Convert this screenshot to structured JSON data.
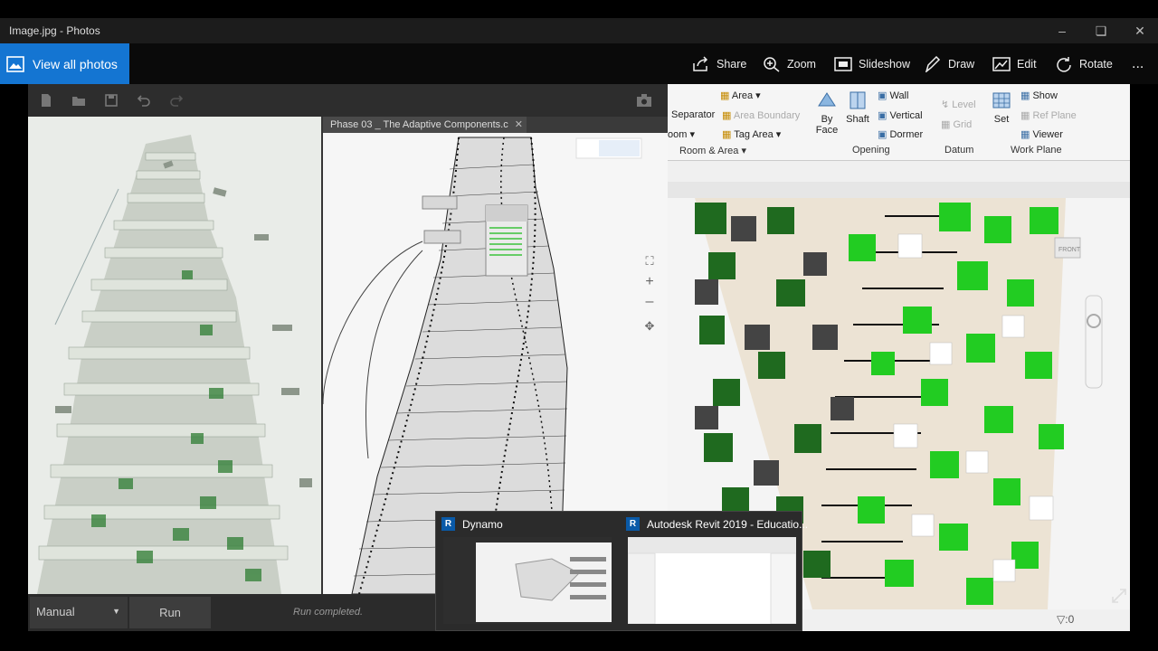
{
  "window": {
    "title": "Image.jpg - Photos"
  },
  "photos_toolbar": {
    "view_all": "View all photos",
    "buttons": [
      "Share",
      "Zoom",
      "Slideshow",
      "Draw",
      "Edit",
      "Rotate"
    ],
    "more": "..."
  },
  "dynamo": {
    "tab_title": "Phase 03 _ The Adaptive Components.c",
    "run_mode": "Manual",
    "run_button": "Run",
    "status": "Run completed."
  },
  "revit": {
    "ribbon": {
      "room_col": {
        "separator": "Separator",
        "room": "oom",
        "area": "Area",
        "area_boundary": "Area Boundary",
        "tag_area": "Tag Area"
      },
      "opening": {
        "by_face": "By\nFace",
        "shaft": "Shaft",
        "wall": "Wall",
        "vertical": "Vertical",
        "dormer": "Dormer"
      },
      "datum": {
        "level": "Level",
        "grid": "Grid"
      },
      "work_plane": {
        "set": "Set",
        "show": "Show",
        "ref_plane": "Ref Plane",
        "viewer": "Viewer"
      },
      "groups": [
        "Room & Area",
        "Opening",
        "Datum",
        "Work Plane"
      ]
    },
    "view_cube_label": "FRONT",
    "status_filter": ":0"
  },
  "taskbar_thumbs": [
    {
      "app": "Dynamo"
    },
    {
      "app": "Autodesk Revit 2019 - Educatio..."
    }
  ],
  "colors": {
    "accent": "#1475d2",
    "revit_green": "#22cc22",
    "dark_green": "#1f6a1f"
  }
}
